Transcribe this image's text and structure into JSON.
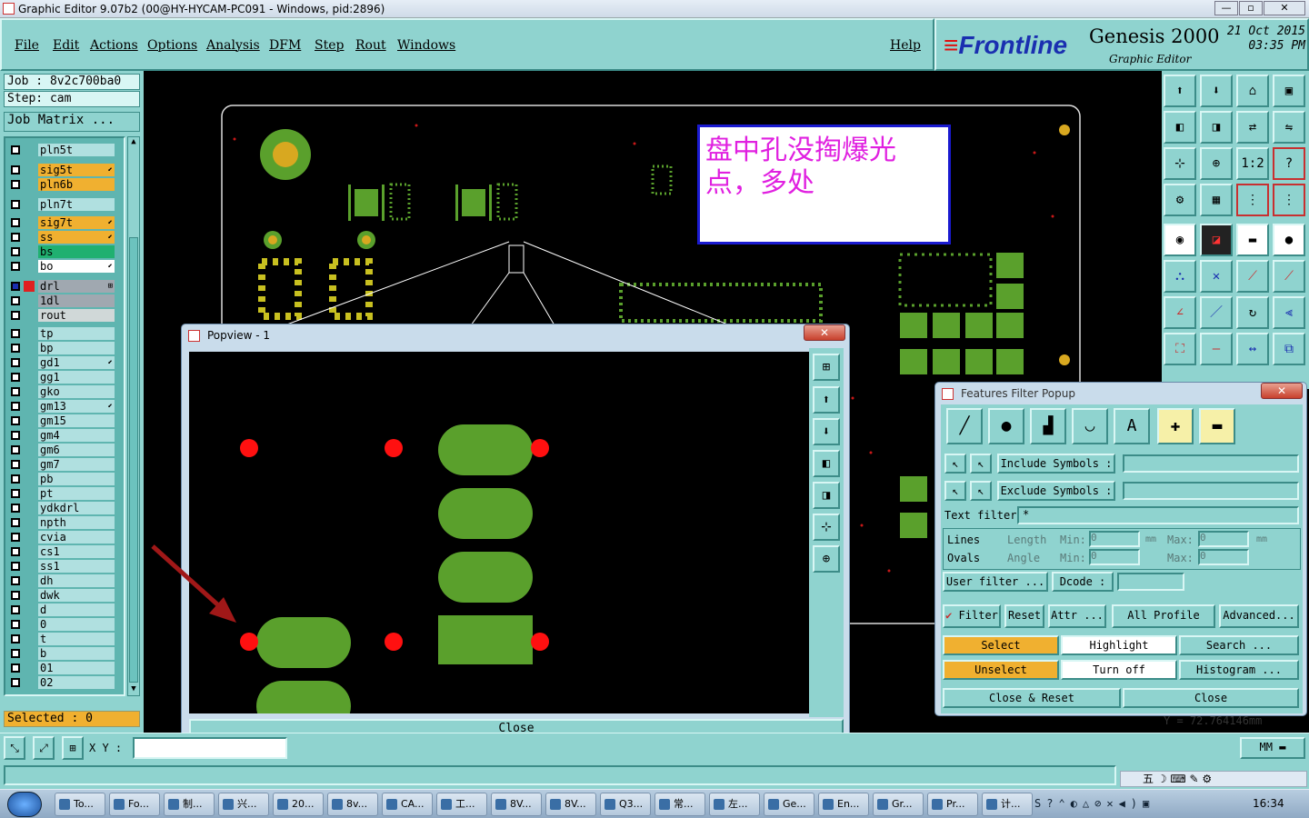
{
  "window": {
    "title": "Graphic Editor 9.07b2 (00@HY-HYCAM-PC091 - Windows, pid:2896)"
  },
  "menu": {
    "items": [
      "File",
      "Edit",
      "Actions",
      "Options",
      "Analysis",
      "DFM",
      "Step",
      "Rout",
      "Windows"
    ],
    "help": "Help"
  },
  "brand": {
    "logo": "Frontline",
    "product": "Genesis 2000",
    "subtitle": "Graphic Editor",
    "date": "21 Oct 2015",
    "time": "03:35 PM"
  },
  "job": {
    "job_label": "Job  : 8v2c700ba0",
    "step_label": "Step: cam",
    "matrix_button": "Job Matrix ...",
    "selected": "Selected : 0"
  },
  "layers": [
    {
      "name": "pln5t",
      "color": "#b0e0e0",
      "mark": ""
    },
    {
      "name": "sig5t",
      "color": "#f0b030",
      "mark": "⬋"
    },
    {
      "name": "pln6b",
      "color": "#f0b030",
      "mark": ""
    },
    {
      "name": "pln7t",
      "color": "#b0e0e0",
      "mark": ""
    },
    {
      "name": "sig7t",
      "color": "#f0b030",
      "mark": "⬋"
    },
    {
      "name": "ss",
      "color": "#f0b030",
      "mark": "⬋"
    },
    {
      "name": "bs",
      "color": "#20b070",
      "mark": ""
    },
    {
      "name": "bo",
      "color": "#ffffff",
      "mark": "⬋"
    },
    {
      "name": "drl",
      "color": "#a0a8b0",
      "mark": "⊞"
    },
    {
      "name": "1dl",
      "color": "#a0a8b0",
      "mark": ""
    },
    {
      "name": "rout",
      "color": "#d0d8d8",
      "mark": ""
    },
    {
      "name": "tp",
      "color": "#b0e0e0",
      "mark": ""
    },
    {
      "name": "bp",
      "color": "#b0e0e0",
      "mark": ""
    },
    {
      "name": "gd1",
      "color": "#b0e0e0",
      "mark": "⬋"
    },
    {
      "name": "gg1",
      "color": "#b0e0e0",
      "mark": ""
    },
    {
      "name": "gko",
      "color": "#b0e0e0",
      "mark": ""
    },
    {
      "name": "gm13",
      "color": "#b0e0e0",
      "mark": "⬋"
    },
    {
      "name": "gm15",
      "color": "#b0e0e0",
      "mark": ""
    },
    {
      "name": "gm4",
      "color": "#b0e0e0",
      "mark": ""
    },
    {
      "name": "gm6",
      "color": "#b0e0e0",
      "mark": ""
    },
    {
      "name": "gm7",
      "color": "#b0e0e0",
      "mark": ""
    },
    {
      "name": "pb",
      "color": "#b0e0e0",
      "mark": ""
    },
    {
      "name": "pt",
      "color": "#b0e0e0",
      "mark": ""
    },
    {
      "name": "ydkdrl",
      "color": "#b0e0e0",
      "mark": ""
    },
    {
      "name": "npth",
      "color": "#b0e0e0",
      "mark": ""
    },
    {
      "name": "cvia",
      "color": "#b0e0e0",
      "mark": ""
    },
    {
      "name": "cs1",
      "color": "#b0e0e0",
      "mark": ""
    },
    {
      "name": "ss1",
      "color": "#b0e0e0",
      "mark": ""
    },
    {
      "name": "dh",
      "color": "#b0e0e0",
      "mark": ""
    },
    {
      "name": "dwk",
      "color": "#b0e0e0",
      "mark": ""
    },
    {
      "name": "d",
      "color": "#b0e0e0",
      "mark": ""
    },
    {
      "name": "0",
      "color": "#b0e0e0",
      "mark": ""
    },
    {
      "name": "t",
      "color": "#b0e0e0",
      "mark": ""
    },
    {
      "name": "b",
      "color": "#b0e0e0",
      "mark": ""
    },
    {
      "name": "01",
      "color": "#b0e0e0",
      "mark": ""
    },
    {
      "name": "02",
      "color": "#b0e0e0",
      "mark": ""
    }
  ],
  "annotation": {
    "text": "盘中孔没掏爆光点，多处"
  },
  "popview": {
    "title": "Popview - 1",
    "close_label": "Close"
  },
  "filter": {
    "title": "Features Filter Popup",
    "include_label": "Include Symbols :",
    "exclude_label": "Exclude Symbols :",
    "text_filter_label": "Text filter",
    "text_filter_value": "*",
    "lines_label": "Lines",
    "ovals_label": "Ovals",
    "length_label": "Length",
    "angle_label": "Angle",
    "min_label": "Min:",
    "max_label": "Max:",
    "unit": "mm",
    "min_value": "0",
    "max_value": "0",
    "user_filter_label": "User filter ...",
    "dcode_label": "Dcode :",
    "filter_toggle": "Filter",
    "reset": "Reset",
    "attr": "Attr ...",
    "all_profile": "All Profile",
    "advanced": "Advanced...",
    "select": "Select",
    "highlight": "Highlight",
    "search": "Search ...",
    "unselect": "Unselect",
    "turn_off": "Turn off",
    "histogram": "Histogram ...",
    "close_reset": "Close & Reset",
    "close": "Close"
  },
  "bottom": {
    "xy_label": "X Y :",
    "units": "MM",
    "coord": "Y = 72.764146mm"
  },
  "taskbar": {
    "tasks": [
      "To...",
      "Fo...",
      "制...",
      "兴...",
      "20...",
      "8v...",
      "CA...",
      "工...",
      "8V...",
      "8V...",
      "Q3...",
      "常...",
      "左...",
      "Ge...",
      "En...",
      "Gr...",
      "Pr...",
      "计..."
    ],
    "tray_ime": "五",
    "clock": "16:34"
  }
}
